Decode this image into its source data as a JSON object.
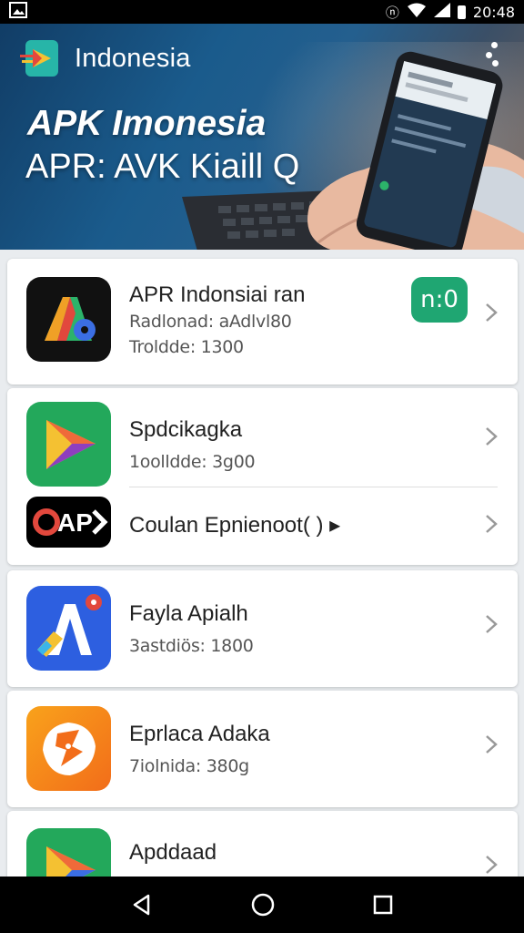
{
  "status_bar": {
    "time": "20:48",
    "icons": [
      "image-icon",
      "nfc-icon",
      "wifi-icon",
      "signal-icon",
      "battery-icon"
    ]
  },
  "header": {
    "title": "Indonesia",
    "menu_icon": "more-vertical-icon"
  },
  "hero": {
    "headline": "APK Imonesia",
    "subheadline": "APR: AVK Kiaill Q"
  },
  "apps": [
    {
      "name": "APR Indonsiai ran",
      "line1": "Radlonad: aAdlvl80",
      "line2": "Troldde: 1300",
      "badge": "n:0"
    },
    {
      "name": "Spdcikagka",
      "line1": "1oolldde: 3g00"
    },
    {
      "name": "Coulan Epnienoot( ) ▸"
    },
    {
      "name": "Fayla Apialh",
      "line1": "3astdiös: 1800"
    },
    {
      "name": "Eprlaca Adaka",
      "line1": "7iolnida: 380g"
    },
    {
      "name": "Apddaad",
      "line1": ""
    }
  ],
  "nav": {
    "icons": [
      "back-icon",
      "home-icon",
      "recents-icon"
    ]
  },
  "colors": {
    "badge": "#1fa672",
    "hero_start": "#113d66",
    "nav": "#000000"
  }
}
